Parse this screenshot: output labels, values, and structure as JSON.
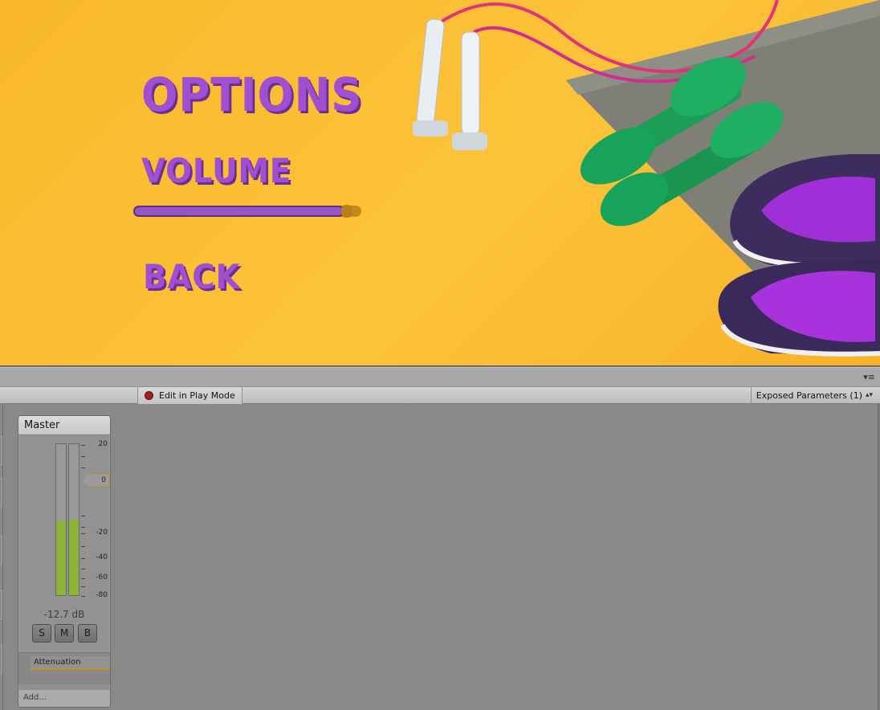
{
  "game": {
    "title": "OPTIONS",
    "volume_label": "VOLUME",
    "back_label": "BACK",
    "volume_slider_value": 0.96
  },
  "toolbar": {
    "edit_play_mode": "Edit in Play Mode",
    "exposed_parameters": "Exposed Parameters (1)"
  },
  "mixer": {
    "group_name": "Master",
    "fader_value": "0",
    "db_readout": "-12.7 dB",
    "meter_level_left": 0.49,
    "meter_level_right": 0.5,
    "scale_labels": [
      "20",
      "0",
      "-20",
      "-40",
      "-60",
      "-80"
    ],
    "buttons": {
      "solo": "S",
      "mute": "M",
      "bypass": "B"
    },
    "effect": "Attenuation",
    "add_label": "Add...",
    "colors": {
      "meter": "#8cb53a",
      "accent": "#c4922a",
      "text_purple": "#a04fd0"
    }
  }
}
